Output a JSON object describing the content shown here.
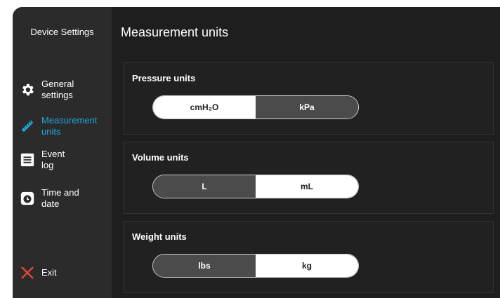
{
  "sidebar": {
    "title": "Device Settings",
    "items": [
      {
        "label_l1": "General",
        "label_l2": "settings",
        "icon": "gear-icon",
        "active": false
      },
      {
        "label_l1": "Measurement",
        "label_l2": "units",
        "icon": "ruler-icon",
        "active": true
      },
      {
        "label_l1": "Event",
        "label_l2": "log",
        "icon": "list-icon",
        "active": false
      },
      {
        "label_l1": "Time and",
        "label_l2": "date",
        "icon": "clock-icon",
        "active": false
      }
    ],
    "exit_label": "Exit"
  },
  "main": {
    "title": "Measurement units",
    "pressure": {
      "label": "Pressure units",
      "option1": "cmH₂O",
      "option2": "kPa",
      "selected": "cmH₂O"
    },
    "volume": {
      "label": "Volume units",
      "option1": "L",
      "option2": "mL",
      "selected": "mL"
    },
    "weight": {
      "label": "Weight units",
      "option1": "lbs",
      "option2": "kg",
      "selected": "kg"
    }
  },
  "colors": {
    "accent": "#1fa8e0",
    "exit_icon": "#e8453c"
  }
}
